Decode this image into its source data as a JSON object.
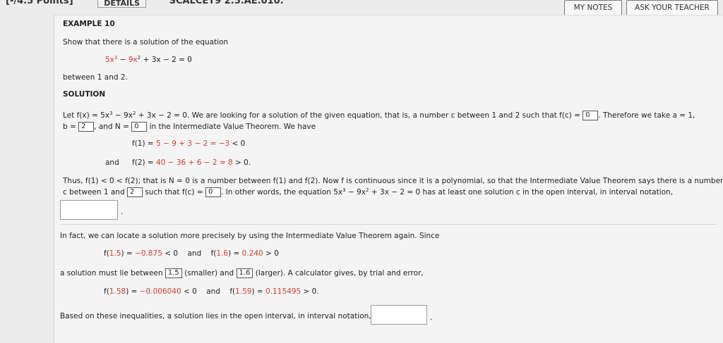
{
  "header": {
    "points": "[-/4.5 Points]",
    "details": "DETAILS",
    "problem_code": "SCALCET9 2.5.AE.010.",
    "my_notes": "MY NOTES",
    "ask_teacher": "ASK YOUR TEACHER"
  },
  "example": {
    "title": "EXAMPLE 10",
    "prompt": "Show that there is a solution of the equation",
    "equation": {
      "c1": "5x",
      "e1": "3",
      "op1": " − ",
      "c2": "9x",
      "e2": "2",
      "rest": " + 3x − 2 = 0"
    },
    "between": "between 1 and 2.",
    "solution_heading": "SOLUTION"
  },
  "solution": {
    "line1": {
      "let": "Let ",
      "fx": "f(x) = ",
      "c1": "5x",
      "e1": "3",
      "op1": " − ",
      "c2": "9x",
      "e2": "2",
      "rest": " + 3x − 2 = 0. We are looking for a solution of the given equation, that is, a number c between 1 and 2 such that f(c) = ",
      "fc_answer": "0",
      "tail": ". Therefore we take a = 1,"
    },
    "line2": {
      "b": "b = ",
      "b_answer": "2",
      "mid": ", and N = ",
      "n_answer": "0",
      "tail": "in the Intermediate Value Theorem. We have"
    },
    "f1": {
      "lhs": "f(1) = ",
      "expr": "5 − 9 + 3 − 2 = −3",
      "rhs": " < 0"
    },
    "and_label": "and",
    "f2": {
      "lhs": "f(2) = ",
      "expr": "40 − 36 + 6 − 2 = 8",
      "rhs": " > 0."
    },
    "thus1": "Thus, f(1) < 0 < f(2); that is N = 0 is a number between f(1) and f(2). Now f is continuous since it is a polynomial, so that the Intermediate Value Theorem says there is a number",
    "thus2": {
      "a": "c between 1 and ",
      "ans1": "2",
      "b": "such that f(c) = ",
      "ans2": "0",
      "c": ". In other words, the equation ",
      "c1": "5x",
      "e1": "3",
      "op1": " − ",
      "c2": "9x",
      "e2": "2",
      "d": " + 3x − 2 = 0 has at least one solution c in the open interval, in interval notation,"
    },
    "interval_answer": "",
    "period": "."
  },
  "refine": {
    "intro": "In fact, we can locate a solution more precisely by using the Intermediate Value Theorem again. Since",
    "row1": {
      "a_lhs": "f(",
      "a_arg": "1.5",
      "a_mid": ") = ",
      "a_val": "−0.875",
      "a_rhs": " < 0",
      "and": "and",
      "b_lhs": "f(",
      "b_arg": "1.6",
      "b_mid": ") = ",
      "b_val": "0.240",
      "b_rhs": " > 0"
    },
    "must_lie": {
      "a": "a solution must lie between ",
      "ans1": "1.5",
      "b": " (smaller) and ",
      "ans2": "1.6",
      "c": " (larger). A calculator gives, by trial and error,"
    },
    "row2": {
      "a_lhs": "f(",
      "a_arg": "1.58",
      "a_mid": ") = ",
      "a_val": "−0.006040",
      "a_rhs": " < 0",
      "and": "and",
      "b_lhs": "f(",
      "b_arg": "1.59",
      "b_mid": ") = ",
      "b_val": "0.115495",
      "b_rhs": " > 0."
    },
    "conclusion": "Based on these inequalities, a solution lies in the open interval, in interval notation,",
    "final_answer": "",
    "period": "."
  },
  "colors": {
    "highlight": "#d33a3a",
    "panel": "#f4f4f4",
    "background": "#ececec"
  }
}
